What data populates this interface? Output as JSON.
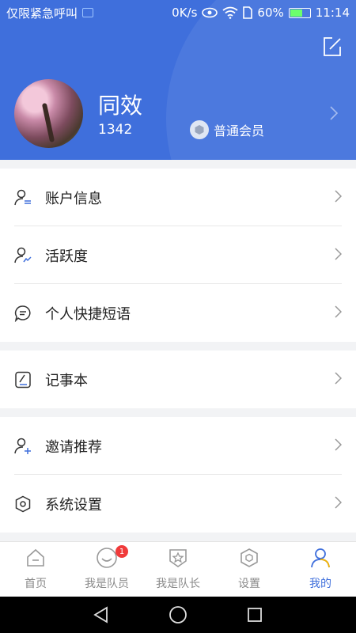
{
  "status_bar": {
    "carrier_text": "仅限紧急呼叫",
    "net_speed": "0K/s",
    "battery_percent": "60%",
    "time": "11:14",
    "battery_level": 0.6
  },
  "profile": {
    "name": "同效",
    "id": "1342",
    "member_level": "普通会员"
  },
  "menu_groups": [
    [
      {
        "label": "账户信息",
        "icon": "user-list-icon"
      },
      {
        "label": "活跃度",
        "icon": "user-activity-icon"
      },
      {
        "label": "个人快捷短语",
        "icon": "chat-bubble-icon"
      }
    ],
    [
      {
        "label": "记事本",
        "icon": "notebook-icon"
      }
    ],
    [
      {
        "label": "邀请推荐",
        "icon": "user-add-icon"
      },
      {
        "label": "系统设置",
        "icon": "hexagon-settings-icon"
      }
    ]
  ],
  "tabbar": {
    "tabs": [
      {
        "label": "首页",
        "icon": "home-icon"
      },
      {
        "label": "我是队员",
        "icon": "smile-icon",
        "badge": "1"
      },
      {
        "label": "我是队长",
        "icon": "star-shield-icon"
      },
      {
        "label": "设置",
        "icon": "settings-hex-icon"
      },
      {
        "label": "我的",
        "icon": "profile-icon",
        "active": true
      }
    ]
  },
  "colors": {
    "primary": "#3f6fdc",
    "badge_red": "#f03a3a"
  }
}
